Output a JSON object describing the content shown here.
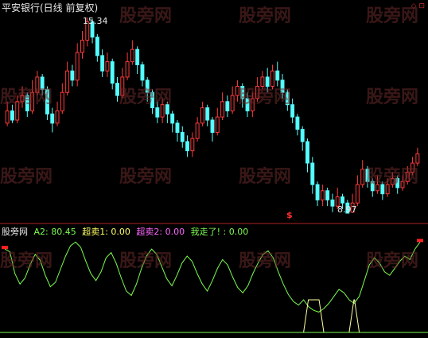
{
  "price_panel": {
    "title": "平安银行(日线 前复权)",
    "high_label": "15.34",
    "low_label": "8.97",
    "corner_marks": "◇ ⊡",
    "sell_signal": "$"
  },
  "indicator_panel": {
    "name": "股旁网",
    "a2_label": "A2: 80.45",
    "overbuy1_label": "超卖1: 0.00",
    "overbuy2_label": "超卖2: 0.00",
    "ran_label": "我走了! : 0.00"
  },
  "watermark": "股旁网",
  "colors": {
    "up": "#ff3b3b",
    "down": "#54ffff",
    "indicator_line": "#7cfc50",
    "sell_box": "#ffffa0",
    "background": "#000000",
    "divider": "#b22222",
    "a2_text": "#7cfc50",
    "overbuy1_text": "#ffff66",
    "overbuy2_text": "#ff66ff",
    "ran_text": "#7cfc50"
  },
  "chart_data": {
    "type": "candlestick",
    "candles": [
      [
        11.9,
        12.3,
        12.6,
        11.8
      ],
      [
        12.3,
        12.0,
        12.5,
        11.9
      ],
      [
        12.0,
        12.6,
        12.8,
        11.9
      ],
      [
        12.6,
        12.8,
        13.1,
        12.4
      ],
      [
        12.8,
        12.3,
        12.9,
        12.1
      ],
      [
        12.3,
        12.9,
        13.3,
        12.2
      ],
      [
        12.9,
        13.4,
        13.6,
        12.8
      ],
      [
        13.4,
        13.0,
        13.5,
        12.8
      ],
      [
        13.0,
        12.2,
        13.1,
        12.0
      ],
      [
        12.2,
        11.9,
        12.4,
        11.6
      ],
      [
        11.9,
        12.3,
        12.6,
        11.8
      ],
      [
        12.3,
        12.9,
        13.2,
        12.2
      ],
      [
        12.9,
        13.6,
        13.9,
        12.8
      ],
      [
        13.6,
        13.3,
        13.8,
        13.1
      ],
      [
        13.3,
        14.2,
        14.5,
        13.1
      ],
      [
        14.2,
        14.6,
        14.9,
        14.0
      ],
      [
        14.6,
        15.2,
        15.34,
        14.4
      ],
      [
        15.2,
        14.7,
        15.3,
        14.5
      ],
      [
        14.7,
        14.1,
        14.8,
        13.9
      ],
      [
        14.1,
        13.6,
        14.3,
        13.4
      ],
      [
        13.6,
        13.9,
        14.2,
        13.4
      ],
      [
        13.9,
        13.2,
        14.0,
        13.0
      ],
      [
        13.2,
        12.8,
        13.4,
        12.6
      ],
      [
        12.8,
        13.4,
        13.7,
        12.7
      ],
      [
        13.4,
        13.9,
        14.2,
        13.3
      ],
      [
        13.9,
        14.3,
        14.6,
        13.8
      ],
      [
        14.3,
        13.8,
        14.4,
        13.5
      ],
      [
        13.8,
        13.3,
        13.9,
        13.1
      ],
      [
        13.3,
        12.9,
        13.4,
        12.6
      ],
      [
        12.9,
        12.4,
        13.0,
        12.2
      ],
      [
        12.4,
        12.1,
        12.6,
        11.9
      ],
      [
        12.1,
        12.5,
        12.7,
        11.9
      ],
      [
        12.5,
        12.2,
        12.6,
        11.9
      ],
      [
        12.2,
        11.9,
        12.3,
        11.6
      ],
      [
        11.9,
        11.6,
        12.0,
        11.3
      ],
      [
        11.6,
        11.3,
        11.8,
        11.1
      ],
      [
        11.3,
        11.0,
        11.5,
        10.8
      ],
      [
        11.0,
        11.4,
        11.6,
        10.8
      ],
      [
        11.4,
        11.9,
        12.1,
        11.3
      ],
      [
        11.9,
        12.4,
        12.6,
        11.8
      ],
      [
        12.4,
        12.0,
        12.5,
        11.8
      ],
      [
        12.0,
        11.6,
        12.1,
        11.3
      ],
      [
        11.6,
        12.1,
        12.4,
        11.5
      ],
      [
        12.1,
        12.6,
        12.9,
        12.0
      ],
      [
        12.6,
        12.3,
        12.8,
        12.1
      ],
      [
        12.3,
        12.8,
        13.1,
        12.2
      ],
      [
        12.8,
        13.1,
        13.3,
        12.6
      ],
      [
        13.1,
        12.7,
        13.2,
        12.4
      ],
      [
        12.7,
        12.3,
        12.9,
        12.1
      ],
      [
        12.3,
        12.7,
        12.9,
        12.1
      ],
      [
        12.7,
        13.1,
        13.4,
        12.6
      ],
      [
        13.1,
        13.4,
        13.6,
        13.0
      ],
      [
        13.4,
        13.1,
        13.7,
        12.9
      ],
      [
        13.1,
        13.6,
        13.8,
        13.0
      ],
      [
        13.6,
        13.3,
        13.9,
        13.1
      ],
      [
        13.3,
        12.9,
        13.5,
        12.7
      ],
      [
        12.9,
        12.5,
        13.0,
        12.3
      ],
      [
        12.5,
        12.1,
        12.7,
        11.9
      ],
      [
        12.1,
        11.7,
        12.2,
        11.5
      ],
      [
        11.7,
        11.3,
        11.8,
        11.0
      ],
      [
        11.3,
        10.6,
        11.4,
        10.3
      ],
      [
        10.6,
        9.9,
        10.8,
        9.6
      ],
      [
        9.9,
        9.4,
        10.0,
        9.2
      ],
      [
        9.4,
        9.7,
        9.9,
        9.2
      ],
      [
        9.7,
        9.4,
        9.8,
        9.2
      ],
      [
        9.4,
        9.2,
        9.6,
        9.0
      ],
      [
        9.2,
        9.5,
        9.8,
        9.1
      ],
      [
        9.5,
        9.3,
        9.6,
        9.1
      ],
      [
        9.3,
        8.97,
        9.4,
        8.97
      ],
      [
        9.0,
        9.3,
        9.6,
        8.97
      ],
      [
        9.3,
        9.9,
        10.2,
        9.2
      ],
      [
        9.9,
        10.4,
        10.7,
        9.8
      ],
      [
        10.4,
        10.0,
        10.5,
        9.8
      ],
      [
        10.0,
        9.7,
        10.1,
        9.5
      ],
      [
        9.7,
        9.9,
        10.2,
        9.6
      ],
      [
        9.9,
        9.6,
        10.0,
        9.4
      ],
      [
        9.6,
        9.9,
        10.1,
        9.5
      ],
      [
        9.9,
        10.1,
        10.3,
        9.8
      ],
      [
        10.1,
        9.8,
        10.2,
        9.6
      ],
      [
        9.8,
        10.0,
        10.2,
        9.7
      ],
      [
        10.0,
        10.3,
        10.5,
        9.9
      ],
      [
        10.3,
        10.6,
        10.8,
        10.2
      ],
      [
        10.6,
        10.9,
        11.1,
        10.5
      ]
    ],
    "indicator": [
      88,
      85,
      60,
      48,
      55,
      70,
      82,
      75,
      58,
      45,
      50,
      65,
      80,
      92,
      96,
      90,
      74,
      60,
      52,
      62,
      78,
      84,
      72,
      55,
      40,
      35,
      48,
      66,
      80,
      88,
      82,
      68,
      54,
      46,
      58,
      72,
      80,
      74,
      60,
      48,
      40,
      52,
      66,
      76,
      70,
      56,
      44,
      38,
      46,
      60,
      72,
      82,
      86,
      78,
      62,
      48,
      36,
      28,
      24,
      30,
      22,
      18,
      16,
      20,
      26,
      34,
      42,
      38,
      30,
      26,
      34,
      52,
      70,
      78,
      72,
      62,
      58,
      66,
      74,
      80,
      76,
      88,
      96
    ],
    "sell_box_ranges": [
      [
        59,
        63
      ],
      [
        68,
        70
      ]
    ]
  }
}
